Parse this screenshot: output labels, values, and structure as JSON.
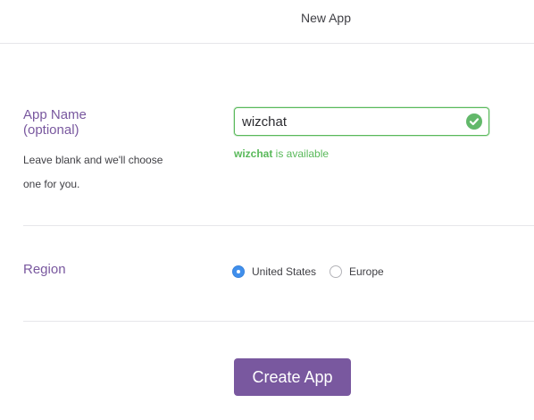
{
  "header": {
    "title": "New App"
  },
  "app_name": {
    "label_line1": "App Name",
    "label_line2": "(optional)",
    "help_text": "Leave blank and we'll choose one for you.",
    "value": "wizchat",
    "status_icon": "check-circle-icon",
    "availability_name": "wizchat",
    "availability_suffix": " is available"
  },
  "region": {
    "label": "Region",
    "options": [
      {
        "label": "United States",
        "selected": true
      },
      {
        "label": "Europe",
        "selected": false
      }
    ]
  },
  "actions": {
    "create_label": "Create App"
  },
  "colors": {
    "accent": "#79589f",
    "success": "#59b95a",
    "radio_selected": "#408fec"
  }
}
